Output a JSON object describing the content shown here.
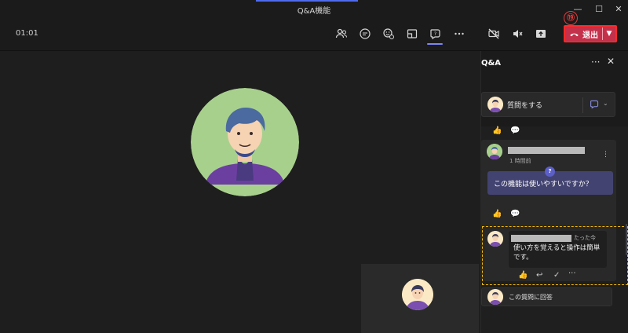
{
  "window": {
    "title": "Q&A機能",
    "minimize": "—",
    "maximize": "☐",
    "close": "✕"
  },
  "toolbar": {
    "timer": "01:01",
    "icons": [
      "people-icon",
      "chat-icon",
      "reactions-icon",
      "rooms-icon",
      "qna-icon",
      "more-icon",
      "camera-off-icon",
      "mic-off-icon",
      "share-icon"
    ],
    "leave_label": "退出",
    "leave_color": "#c4314b"
  },
  "annotation": {
    "marker": "⑲",
    "highlight_color": "#f2b705"
  },
  "qna": {
    "title": "Q&A",
    "more": "···",
    "close": "✕",
    "ask_label": "質問をする",
    "question": {
      "time": "1 時間前",
      "text": "この機能は使いやすいですか？",
      "badge": "?"
    },
    "reply": {
      "time": "たった今",
      "text": "使い方を覚えると操作は簡単です。",
      "more": "···"
    },
    "answer_placeholder": "この質問に回答"
  },
  "colors": {
    "accent": "#4f6bed",
    "panel_bg": "#1b1b1b",
    "question_bg": "#434371",
    "avatar_bg": "#a8d08d"
  }
}
